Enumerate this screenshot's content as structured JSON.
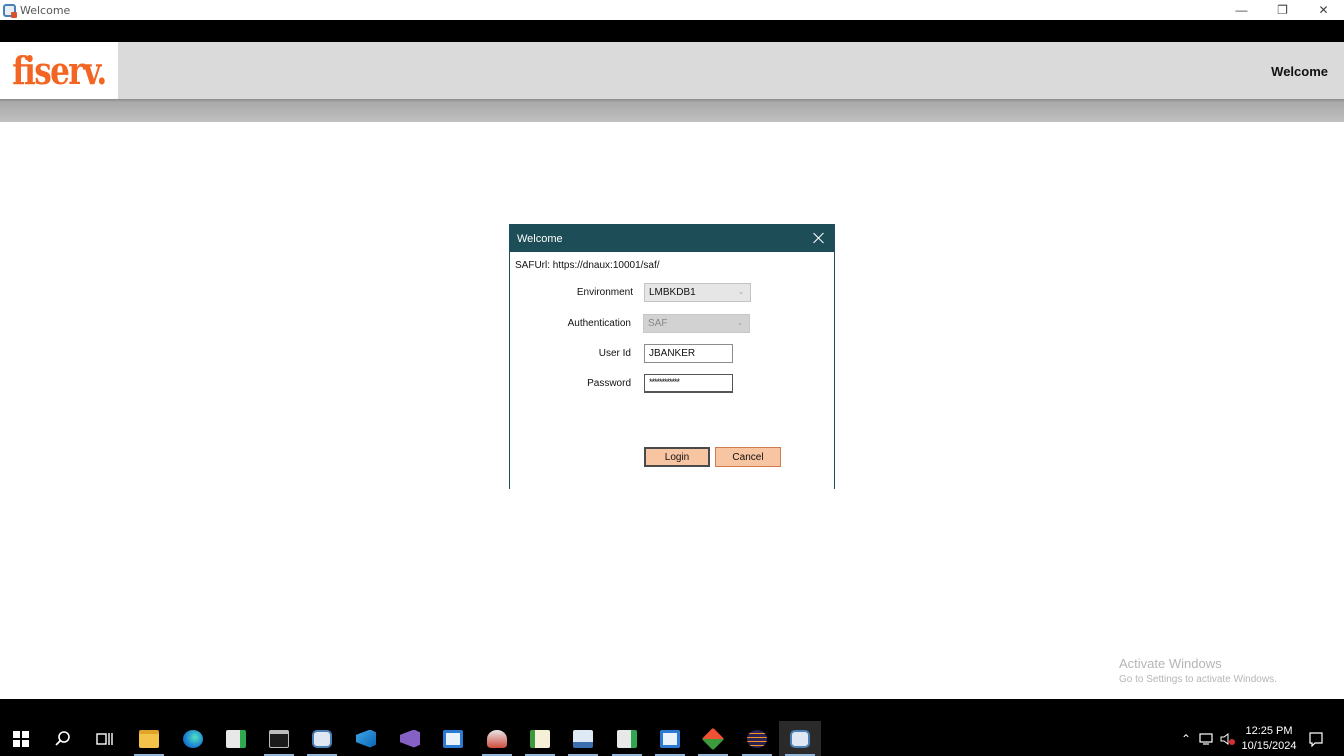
{
  "window": {
    "title": "Welcome",
    "minimize": "—",
    "restore": "❐",
    "close": "✕"
  },
  "header": {
    "logo_text": "fiserv.",
    "title": "Welcome"
  },
  "dialog": {
    "title": "Welcome",
    "saf_url": "SAFUrl: https://dnaux:10001/saf/",
    "environment_label": "Environment",
    "environment_value": "LMBKDB1",
    "authentication_label": "Authentication",
    "authentication_value": "SAF",
    "userid_label": "User Id",
    "userid_value": "JBANKER",
    "password_label": "Password",
    "password_value": "************",
    "login_label": "Login",
    "cancel_label": "Cancel"
  },
  "watermark": {
    "title": "Activate Windows",
    "subtitle": "Go to Settings to activate Windows."
  },
  "taskbar": {
    "time": "12:25 PM",
    "date": "10/15/2024"
  }
}
